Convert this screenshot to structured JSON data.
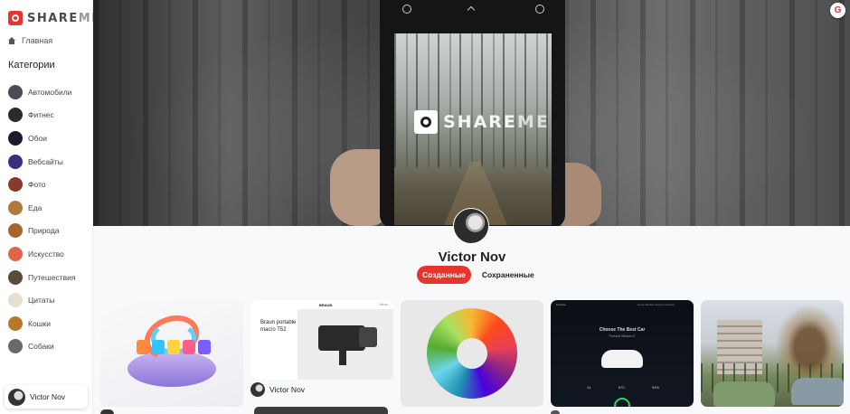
{
  "app": {
    "logo": {
      "part1": "SHARE",
      "part2": "ME"
    }
  },
  "sidebar": {
    "home_label": "Главная",
    "categories_title": "Категории",
    "categories": [
      {
        "label": "Автомобили",
        "color": "#4b4b56"
      },
      {
        "label": "Фитнес",
        "color": "#2b2b2b"
      },
      {
        "label": "Обои",
        "color": "#1b1b2b"
      },
      {
        "label": "Вебсайты",
        "color": "#3a2f7a"
      },
      {
        "label": "Фото",
        "color": "#8a3a2a"
      },
      {
        "label": "Еда",
        "color": "#b07a3a"
      },
      {
        "label": "Природа",
        "color": "#a8642a"
      },
      {
        "label": "Искусство",
        "color": "#e0644a"
      },
      {
        "label": "Путешествия",
        "color": "#5a4a3a"
      },
      {
        "label": "Цитаты",
        "color": "#e6e0d2"
      },
      {
        "label": "Кошки",
        "color": "#b8782a"
      },
      {
        "label": "Собаки",
        "color": "#6a6a6a"
      }
    ],
    "user_chip": {
      "name": "Victor Nov"
    }
  },
  "banner": {
    "phone_logo": {
      "part1": "SHARE",
      "part2": "ME"
    },
    "google_badge": "G"
  },
  "profile": {
    "name": "Victor Nov",
    "tabs": [
      {
        "label": "Созданные",
        "active": true
      },
      {
        "label": "Сохраненные",
        "active": false
      }
    ]
  },
  "pins": [
    {
      "id": "pin-play"
    },
    {
      "id": "pin-braun",
      "text": "Braun portable macro T52",
      "brand": "BRAUN",
      "nav": "Menu",
      "user": "Victor Nov"
    },
    {
      "id": "pin-spiral"
    },
    {
      "id": "pin-porsche",
      "logo": "Porsche",
      "nav": "Home   Models   Support   Contact",
      "title": "Choose The Best Car",
      "subtitle": "Porsche Mission E",
      "stats": [
        "24",
        "870",
        "94%"
      ]
    },
    {
      "id": "pin-street"
    }
  ],
  "colors": {
    "accent": "#e6342f"
  }
}
